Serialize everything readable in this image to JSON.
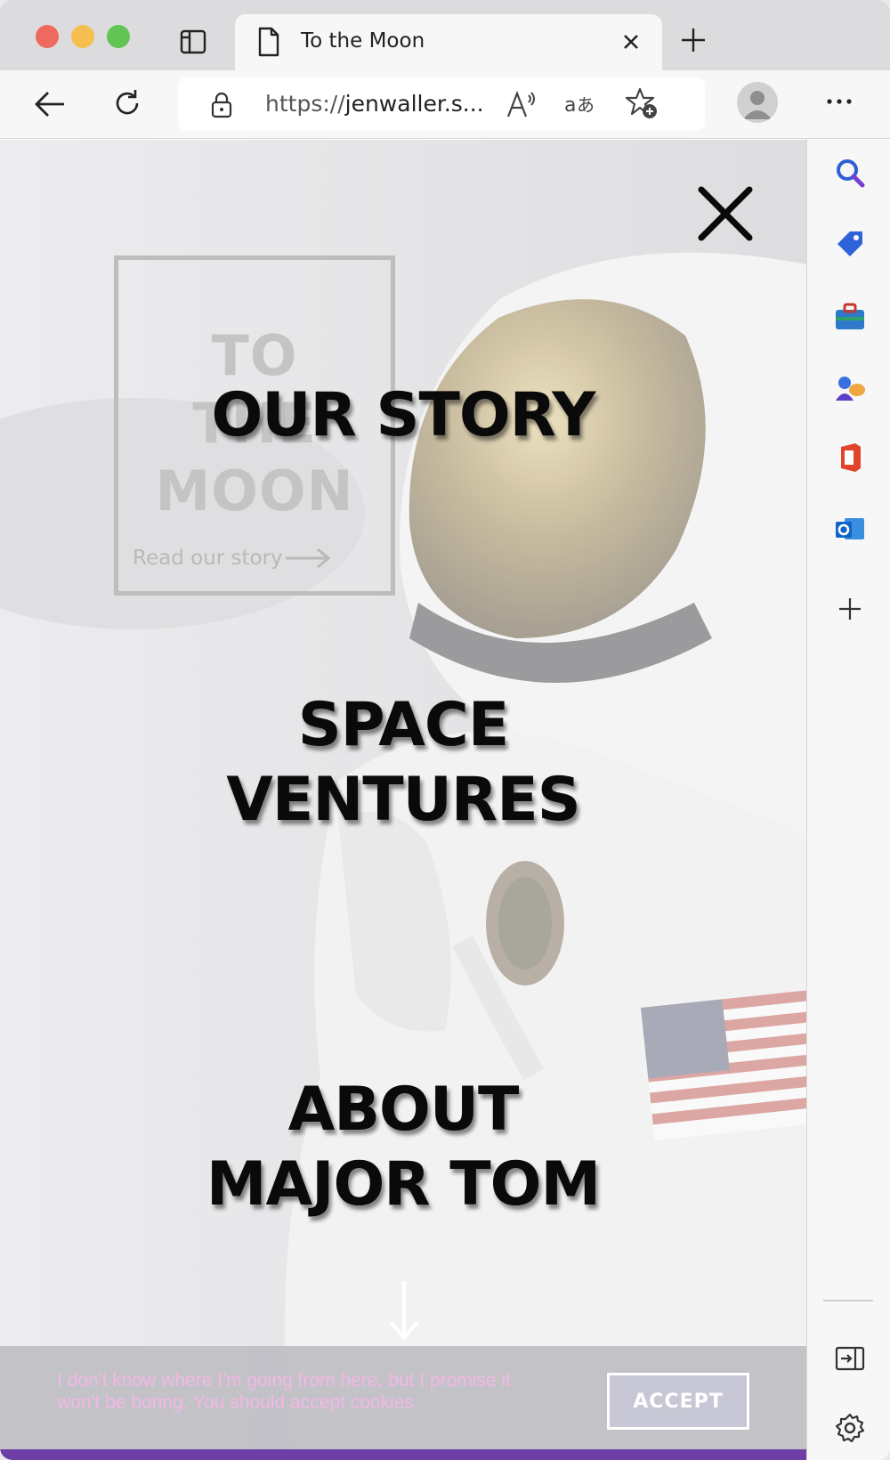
{
  "browser": {
    "tab_title": "To the Moon",
    "url_prefix": "https://",
    "url_host": "jenwaller.s..."
  },
  "icons": {
    "window_controls": [
      "close-window",
      "minimize-window",
      "zoom-window"
    ],
    "tab_bar": [
      "sidebar-toggle-icon",
      "document-icon",
      "close-tab-icon",
      "new-tab-icon"
    ],
    "toolbar": [
      "back-icon",
      "reload-icon",
      "lock-icon",
      "read-aloud-icon",
      "translate-icon",
      "add-favorite-icon",
      "profile-icon",
      "more-icon"
    ],
    "side_panel": [
      "search-icon",
      "shopping-tag-icon",
      "tools-icon",
      "games-icon",
      "office-icon",
      "outlook-icon",
      "add-icon",
      "split-screen-icon",
      "settings-icon"
    ]
  },
  "page": {
    "hero": {
      "title_lines": [
        "TO",
        "THE",
        "MOON"
      ],
      "link_text": "Read our story"
    },
    "menu": {
      "items": [
        {
          "label": "OUR STORY"
        },
        {
          "label_line1": "SPACE",
          "label_line2": "VENTURES"
        },
        {
          "label_line1": "ABOUT",
          "label_line2": "MAJOR TOM"
        }
      ]
    },
    "cookie_banner": {
      "text": "I don't know where I'm going from here, but I promise it won't be boring. You should accept cookies.",
      "accept_label": "ACCEPT"
    }
  },
  "colors": {
    "menu_text": "#0a0a0a",
    "cookie_text": "#f3b8e6",
    "accept_bg": "#c7c7d6",
    "traffic_red": "#ee6a5f",
    "traffic_yellow": "#f5be4f",
    "traffic_green": "#62c454"
  }
}
